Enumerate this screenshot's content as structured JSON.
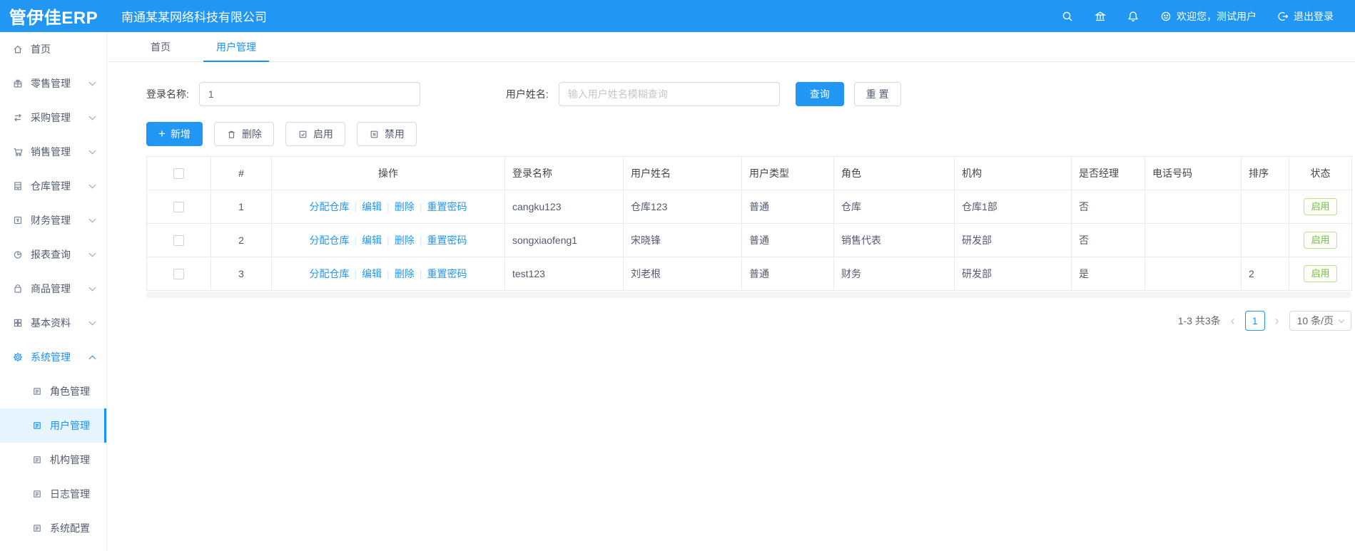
{
  "header": {
    "logo": "管伊佳ERP",
    "company": "南通某某网络科技有限公司",
    "welcome": "欢迎您，测试用户",
    "logout": "退出登录",
    "icons": [
      "search-icon",
      "bank-icon",
      "bell-icon",
      "smile-icon",
      "logout-icon"
    ]
  },
  "sidebar": {
    "items": [
      {
        "label": "首页",
        "icon": "home-icon"
      },
      {
        "label": "零售管理",
        "icon": "gift-icon"
      },
      {
        "label": "采购管理",
        "icon": "swap-icon"
      },
      {
        "label": "销售管理",
        "icon": "cart-icon"
      },
      {
        "label": "仓库管理",
        "icon": "warehouse-icon"
      },
      {
        "label": "财务管理",
        "icon": "finance-icon"
      },
      {
        "label": "报表查询",
        "icon": "pie-chart-icon"
      },
      {
        "label": "商品管理",
        "icon": "bag-icon"
      },
      {
        "label": "基本资料",
        "icon": "grid-icon"
      },
      {
        "label": "系统管理",
        "icon": "gear-icon"
      }
    ],
    "submenu": [
      {
        "label": "角色管理",
        "icon": "form-icon"
      },
      {
        "label": "用户管理",
        "icon": "form-icon"
      },
      {
        "label": "机构管理",
        "icon": "form-icon"
      },
      {
        "label": "日志管理",
        "icon": "form-icon"
      },
      {
        "label": "系统配置",
        "icon": "form-icon"
      }
    ]
  },
  "tabs": [
    {
      "label": "首页"
    },
    {
      "label": "用户管理"
    }
  ],
  "filters": {
    "login_label": "登录名称:",
    "login_value": "1",
    "name_label": "用户姓名:",
    "name_placeholder": "输入用户姓名模糊查询",
    "search_btn": "查询",
    "reset_btn": "重 置"
  },
  "toolbar": {
    "add": "新增",
    "delete": "删除",
    "enable": "启用",
    "disable": "禁用"
  },
  "table": {
    "headers": [
      "",
      "#",
      "操作",
      "登录名称",
      "用户姓名",
      "用户类型",
      "角色",
      "机构",
      "是否经理",
      "电话号码",
      "排序",
      "状态"
    ],
    "op_links": [
      "分配仓库",
      "编辑",
      "删除",
      "重置密码"
    ],
    "rows": [
      {
        "num": "1",
        "login": "cangku123",
        "name": "仓库123",
        "type": "普通",
        "role": "仓库",
        "org": "仓库1部",
        "manager": "否",
        "phone": "",
        "sort": "",
        "status": "启用"
      },
      {
        "num": "2",
        "login": "songxiaofeng1",
        "name": "宋晓锋",
        "type": "普通",
        "role": "销售代表",
        "org": "研发部",
        "manager": "否",
        "phone": "",
        "sort": "",
        "status": "启用"
      },
      {
        "num": "3",
        "login": "test123",
        "name": "刘老根",
        "type": "普通",
        "role": "财务",
        "org": "研发部",
        "manager": "是",
        "phone": "",
        "sort": "2",
        "status": "启用"
      }
    ]
  },
  "pagination": {
    "total": "1-3 共3条",
    "prev": "‹",
    "next": "›",
    "page": "1",
    "page_size": "10 条/页"
  }
}
